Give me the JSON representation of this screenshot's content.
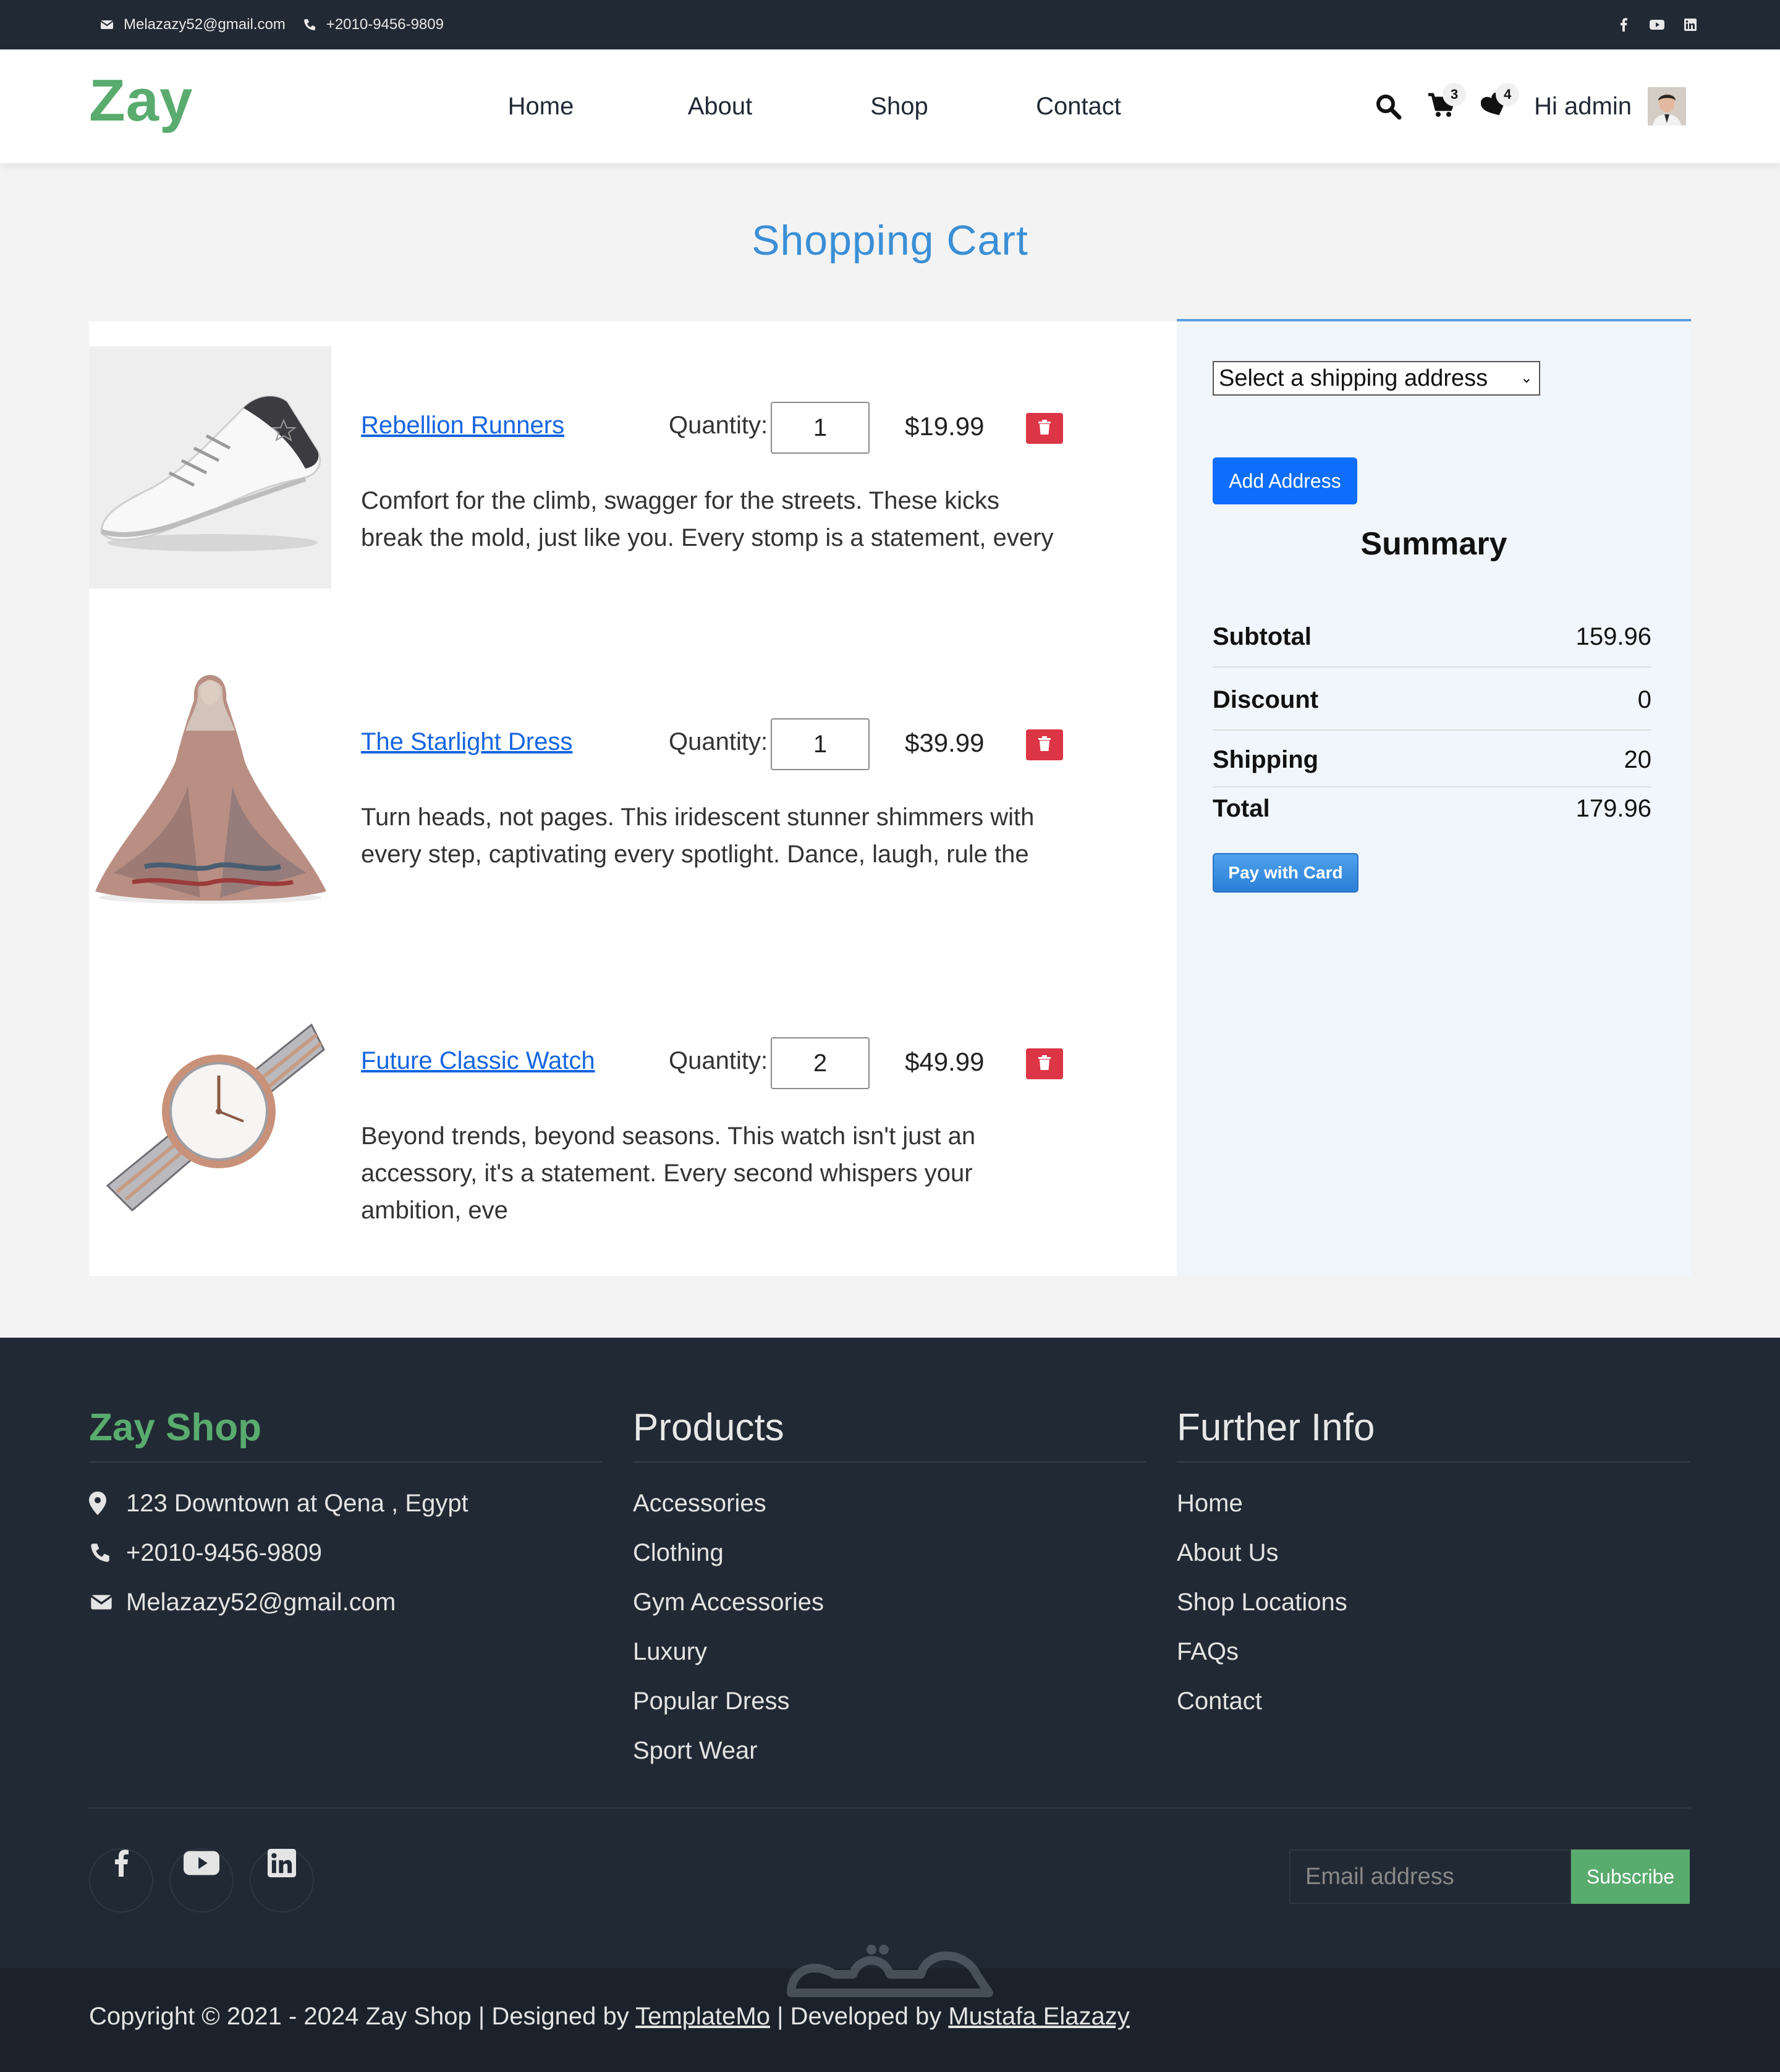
{
  "topbar": {
    "email": "Melazazy52@gmail.com",
    "phone": "+2010-9456-9809",
    "social_icons": [
      "facebook-icon",
      "youtube-icon",
      "linkedin-icon"
    ]
  },
  "navbar": {
    "brand": "Zay",
    "links": [
      "Home",
      "About",
      "Shop",
      "Contact"
    ],
    "cart_count": "3",
    "wishlist_count": "4",
    "greeting": "Hi admin"
  },
  "page_title": "Shopping Cart",
  "cart": {
    "quantity_label": "Quantity:",
    "items": [
      {
        "name": "Rebellion Runners",
        "quantity": "1",
        "price": "$19.99",
        "description": "Comfort for the climb, swagger for the streets. These kicks break the mold, just like you. Every stomp is a statement, every"
      },
      {
        "name": "The Starlight Dress",
        "quantity": "1",
        "price": "$39.99",
        "description": "Turn heads, not pages. This iridescent stunner shimmers with every step, captivating every spotlight. Dance, laugh, rule the"
      },
      {
        "name": "Future Classic Watch",
        "quantity": "2",
        "price": "$49.99",
        "description": "Beyond trends, beyond seasons. This watch isn't just an accessory, it's a statement. Every second whispers your ambition, eve"
      }
    ]
  },
  "summary": {
    "shipping_select": "Select a shipping address",
    "add_address": "Add Address",
    "title": "Summary",
    "subtotal_label": "Subtotal",
    "subtotal": "159.96",
    "discount_label": "Discount",
    "discount": "0",
    "shipping_label": "Shipping",
    "shipping": "20",
    "total_label": "Total",
    "total": "179.96",
    "pay_button": "Pay with Card"
  },
  "footer": {
    "col1_title": "Zay Shop",
    "address": "123 Downtown at Qena , Egypt",
    "phone": "+2010-9456-9809",
    "email": "Melazazy52@gmail.com",
    "col2_title": "Products",
    "products": [
      "Accessories",
      "Clothing",
      "Gym Accessories",
      "Luxury",
      "Popular Dress",
      "Sport Wear"
    ],
    "col3_title": "Further Info",
    "info_links": [
      "Home",
      "About Us",
      "Shop Locations",
      "FAQs",
      "Contact"
    ],
    "email_placeholder": "Email address",
    "subscribe": "Subscribe",
    "copyright_prefix": "Copyright © 2021 - 2024 Zay Shop | Designed by ",
    "templatemo": "TemplateMo",
    "developed_by": " | Developed by ",
    "developer": "Mustafa Elazazy"
  },
  "colors": {
    "brand_green": "#59ab6e",
    "dark": "#212934",
    "title_blue": "#3a8fd5",
    "link_blue": "#1565e0",
    "danger": "#dc3545",
    "primary": "#0d6efd"
  }
}
